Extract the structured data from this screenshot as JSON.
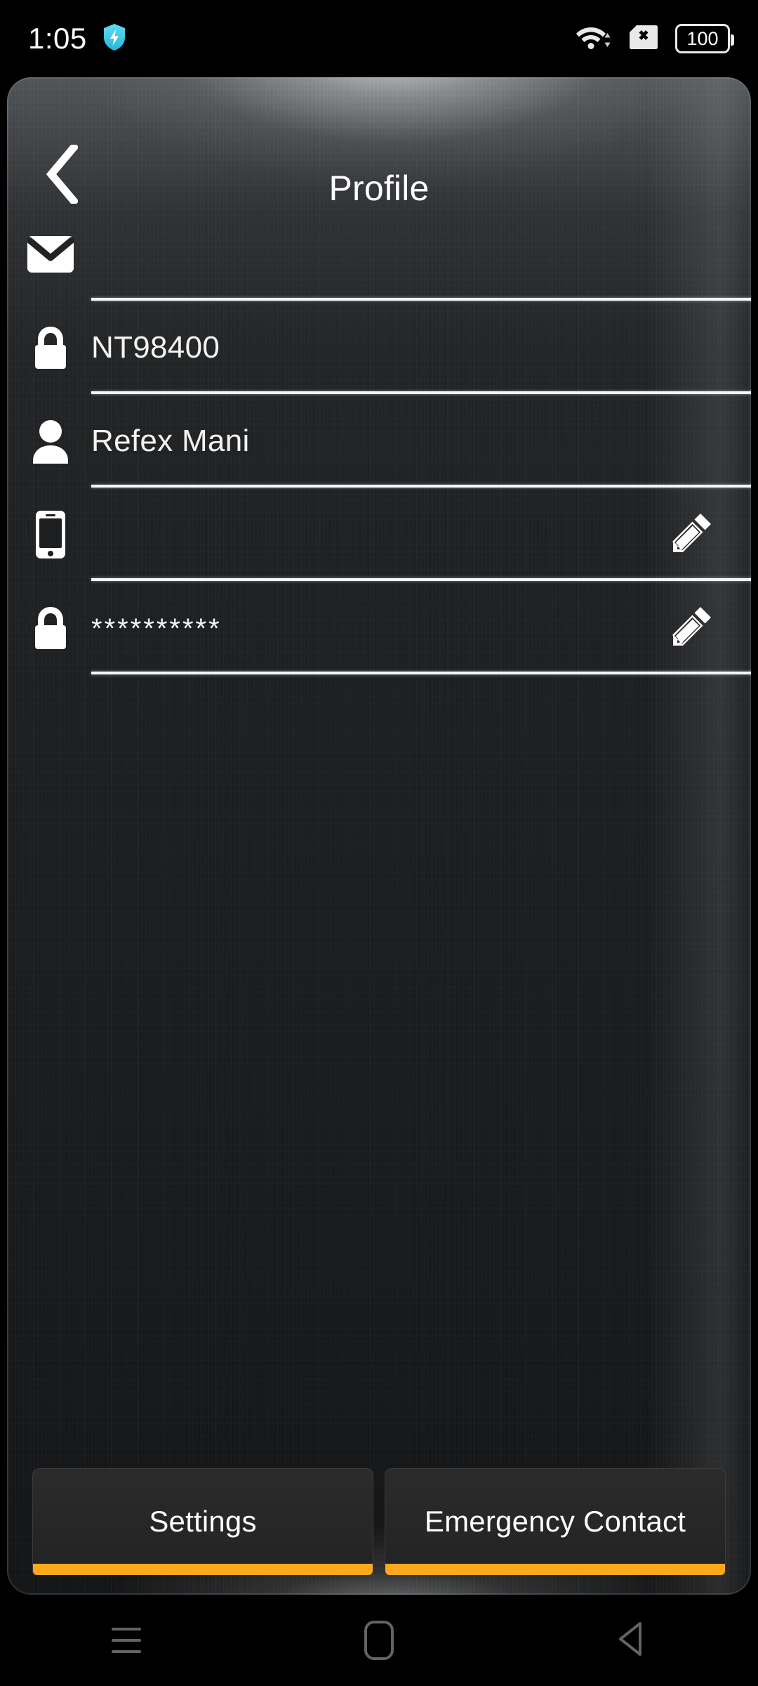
{
  "status_bar": {
    "clock": "1:05",
    "shield_icon": "shield-bolt-icon",
    "wifi_icon": "wifi-icon",
    "sim_icon": "sim-card-off-icon",
    "battery_level": "100",
    "battery_icon": "battery-icon"
  },
  "header": {
    "back_icon": "chevron-left-icon",
    "title": "Profile"
  },
  "fields": [
    {
      "name": "email",
      "icon": "envelope-icon",
      "value": "",
      "placeholder": "",
      "editable": false
    },
    {
      "name": "device-id",
      "icon": "lock-icon",
      "value": "NT98400",
      "placeholder": "",
      "editable": false
    },
    {
      "name": "full-name",
      "icon": "person-icon",
      "value": "Refex Mani",
      "placeholder": "",
      "editable": false
    },
    {
      "name": "phone",
      "icon": "smartphone-icon",
      "value": "",
      "placeholder": "",
      "editable": true,
      "edit_icon": "pencil-icon"
    },
    {
      "name": "password",
      "icon": "lock-icon",
      "value": "**********",
      "placeholder": "",
      "editable": true,
      "edit_icon": "pencil-icon"
    }
  ],
  "actions": {
    "settings_label": "Settings",
    "emergency_label": "Emergency Contact",
    "accent_color": "#ffa81e"
  },
  "nav_bar": {
    "recents_icon": "menu-icon",
    "home_icon": "home-square-icon",
    "back_icon": "back-triangle-icon"
  },
  "colors": {
    "accent": "#ffa81e",
    "panel_dark": "#1d1f21",
    "text": "#ffffff",
    "shield": "#4ecfe8"
  }
}
